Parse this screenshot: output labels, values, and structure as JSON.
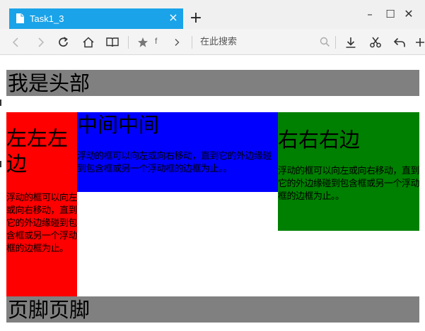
{
  "browser": {
    "tab_title": "Task1_3",
    "tab_close": "×",
    "new_tab": "+",
    "window_controls": {
      "minimize": "–",
      "maximize": "☐",
      "close": "✕"
    },
    "favorites_label": "f",
    "search_placeholder": "在此搜索",
    "icons": [
      "back-icon",
      "forward-icon",
      "refresh-icon",
      "home-icon",
      "reading-view-icon",
      "star-icon",
      "chevron-right-icon",
      "search-icon",
      "download-icon",
      "scissors-icon",
      "undo-icon",
      "plus-icon"
    ]
  },
  "page": {
    "header": "我是头部",
    "left": {
      "title": "左左左边",
      "text": "浮动的框可以向左或向右移动，直到它的外边缘碰到包含框或另一个浮动框的边框为止。"
    },
    "center": {
      "title": "中间中间",
      "text": "浮动的框可以向左或向右移动，直到它的外边缘碰到包含框或另一个浮动框的边框为止。。"
    },
    "right": {
      "title": "右右右边",
      "text": "浮动的框可以向左或向右移动，直到它的外边缘碰到包含框或另一个浮动框的边框为止。。"
    },
    "footer": "页脚页脚"
  },
  "colors": {
    "tab_active": "#1aa3e8",
    "header_bg": "#808080",
    "left_bg": "#ff0000",
    "center_bg": "#0000ff",
    "right_bg": "#008000",
    "footer_bg": "#808080"
  }
}
